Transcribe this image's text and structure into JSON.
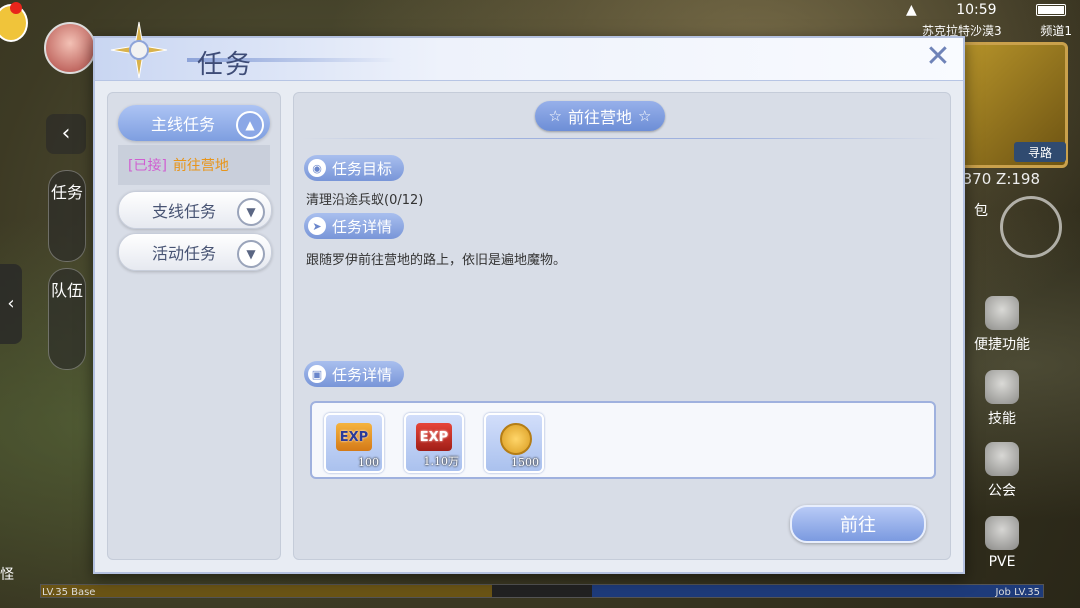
{
  "status_bar": {
    "time": "10:59"
  },
  "hud": {
    "server": "苏克拉特沙漠3",
    "channel": "频道1",
    "coords": "370 Z:198",
    "minimap_search": "寻路",
    "bag_label": "包",
    "right_buttons": [
      "便捷功能",
      "技能",
      "公会",
      "PVE"
    ],
    "left_tabs": [
      "任务",
      "队伍"
    ],
    "bottom_left": "怪",
    "exp_left_label": "LV.35 Base",
    "exp_right_label": "Job LV.35"
  },
  "dialog": {
    "title": "任务",
    "close_icon": "close-icon",
    "tabs": [
      {
        "label": "主线任务",
        "state": "expanded"
      },
      {
        "label": "支线任务",
        "state": "collapsed"
      },
      {
        "label": "活动任务",
        "state": "collapsed"
      }
    ],
    "active_quest": {
      "tag": "[已接]",
      "name": "前往营地"
    },
    "quest_title": "前往营地",
    "sections": {
      "objective_label": "任务目标",
      "objective_text": "清理沿途兵蚁(0/12)",
      "detail_label": "任务详情",
      "detail_text": "跟随罗伊前往营地的路上，依旧是遍地魔物。",
      "rewards_label": "任务详情"
    },
    "rewards": [
      {
        "icon": "exp-icon",
        "text": "EXP",
        "qty": "100"
      },
      {
        "icon": "job-exp-icon",
        "text": "EXP",
        "qty": "1.10万"
      },
      {
        "icon": "zeny-coin-icon",
        "text": "",
        "qty": "1500"
      }
    ],
    "go_button": "前往"
  },
  "colors": {
    "accent": "#7b9ae0",
    "tag_color": "#d05fd1",
    "quest_name_color": "#e8951a"
  }
}
